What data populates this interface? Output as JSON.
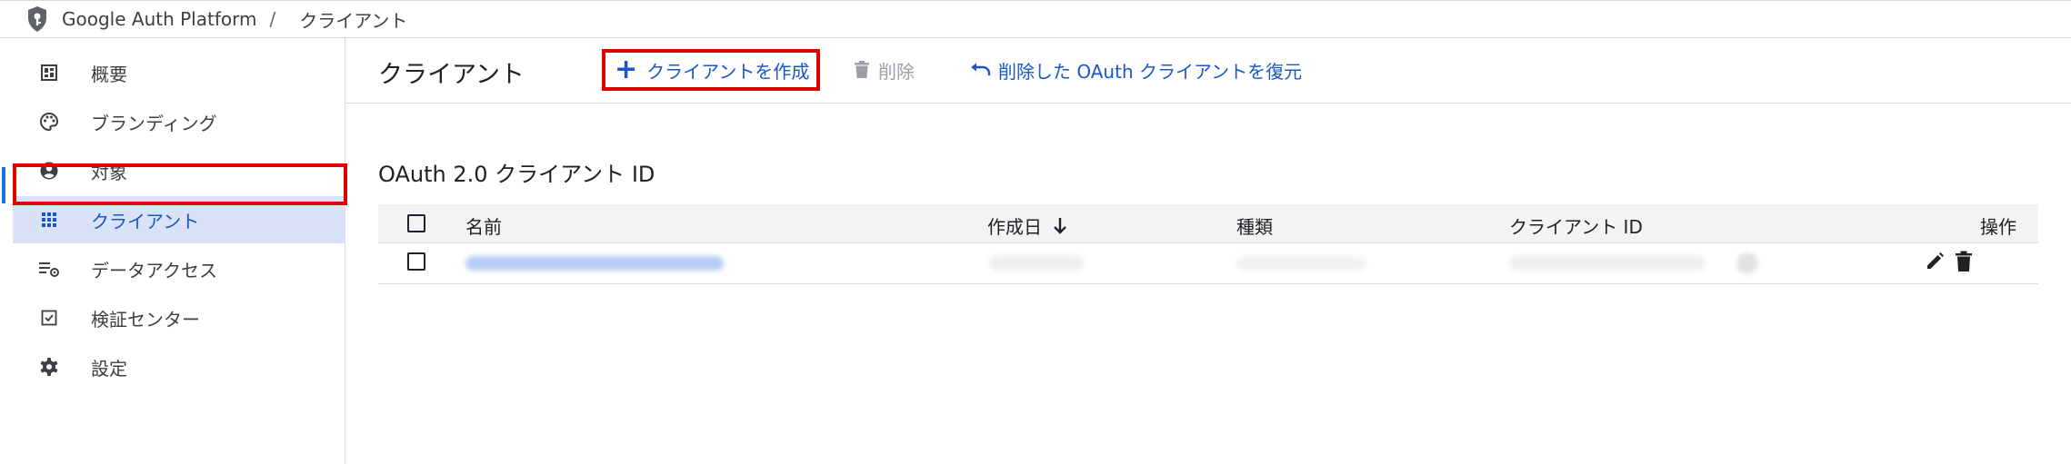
{
  "topbar": {
    "product": "Google Auth Platform",
    "separator": "/",
    "current": "クライアント"
  },
  "sidebar": {
    "items": [
      {
        "label": "概要",
        "icon": "dashboard-icon"
      },
      {
        "label": "ブランディング",
        "icon": "palette-icon"
      },
      {
        "label": "対象",
        "icon": "account-circle-icon"
      },
      {
        "label": "クライアント",
        "icon": "apps-grid-icon",
        "active": true
      },
      {
        "label": "データアクセス",
        "icon": "data-settings-icon"
      },
      {
        "label": "検証センター",
        "icon": "verified-checkbox-icon"
      },
      {
        "label": "設定",
        "icon": "gear-icon"
      }
    ]
  },
  "toolbar": {
    "title": "クライアント",
    "create_label": "クライアントを作成",
    "delete_label": "削除",
    "restore_label": "削除した OAuth クライアントを復元"
  },
  "section_title": "OAuth 2.0 クライアント ID",
  "table": {
    "columns": [
      "名前",
      "作成日",
      "種類",
      "クライアント ID",
      "操作"
    ],
    "sort_column": "作成日",
    "sort_direction": "descending",
    "rows": [
      {
        "redacted": true
      }
    ]
  },
  "colors": {
    "accent": "#1a73e8",
    "link": "#1a56c7",
    "highlight": "#e00000",
    "active_bg": "#d9e2f6"
  }
}
